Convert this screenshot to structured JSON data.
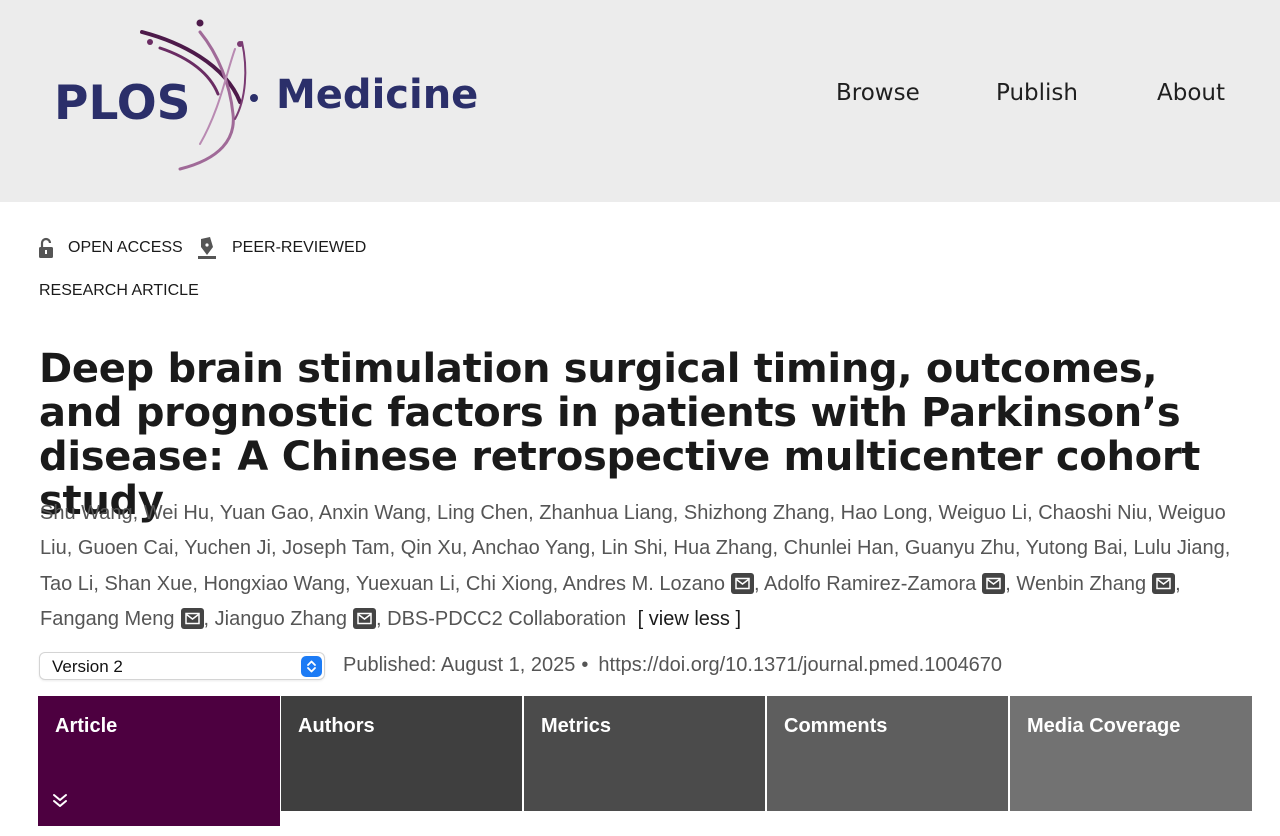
{
  "header": {
    "logo": {
      "plos": "PLOS",
      "journal": "Medicine"
    },
    "nav": [
      "Browse",
      "Publish",
      "About"
    ]
  },
  "badges": {
    "open_access": "OPEN ACCESS",
    "peer_reviewed": "PEER-REVIEWED"
  },
  "article_type": "RESEARCH ARTICLE",
  "title": "Deep brain stimulation surgical timing, outcomes, and prognostic factors in patients with Parkinson’s disease: A Chinese retrospective multicenter cohort study",
  "authors": [
    {
      "name": "Shu Wang",
      "email": false
    },
    {
      "name": "Wei Hu",
      "email": false
    },
    {
      "name": "Yuan Gao",
      "email": false
    },
    {
      "name": "Anxin Wang",
      "email": false
    },
    {
      "name": "Ling Chen",
      "email": false
    },
    {
      "name": "Zhanhua Liang",
      "email": false
    },
    {
      "name": "Shizhong Zhang",
      "email": false
    },
    {
      "name": "Hao Long",
      "email": false
    },
    {
      "name": "Weiguo Li",
      "email": false
    },
    {
      "name": "Chaoshi Niu",
      "email": false
    },
    {
      "name": "Weiguo Liu",
      "email": false
    },
    {
      "name": "Guoen Cai",
      "email": false
    },
    {
      "name": "Yuchen Ji",
      "email": false
    },
    {
      "name": "Joseph Tam",
      "email": false
    },
    {
      "name": "Qin Xu",
      "email": false
    },
    {
      "name": "Anchao Yang",
      "email": false
    },
    {
      "name": "Lin Shi",
      "email": false
    },
    {
      "name": "Hua Zhang",
      "email": false
    },
    {
      "name": "Chunlei Han",
      "email": false
    },
    {
      "name": "Guanyu Zhu",
      "email": false
    },
    {
      "name": "Yutong Bai",
      "email": false
    },
    {
      "name": "Lulu Jiang",
      "email": false
    },
    {
      "name": "Tao Li",
      "email": false
    },
    {
      "name": "Shan Xue",
      "email": false
    },
    {
      "name": "Hongxiao Wang",
      "email": false
    },
    {
      "name": "Yuexuan Li",
      "email": false
    },
    {
      "name": "Chi Xiong",
      "email": false
    },
    {
      "name": "Andres M. Lozano",
      "email": true
    },
    {
      "name": "Adolfo Ramirez-Zamora",
      "email": true
    },
    {
      "name": "Wenbin Zhang",
      "email": true
    },
    {
      "name": "Fangang Meng",
      "email": true
    },
    {
      "name": "Jianguo Zhang",
      "email": true
    },
    {
      "name": "DBS-PDCC2 Collaboration",
      "email": false
    }
  ],
  "view_less": "[ view less ]",
  "version": {
    "selected": "Version 2"
  },
  "published": {
    "text": "Published: August 1, 2025",
    "bullet": "•",
    "doi": "https://doi.org/10.1371/journal.pmed.1004670"
  },
  "tabs": [
    "Article",
    "Authors",
    "Metrics",
    "Comments",
    "Media Coverage"
  ],
  "icons": {
    "open_access": "unlocked-padlock-icon",
    "peer_reviewed": "pen-nib-icon",
    "email": "envelope-icon",
    "select": "updown-arrows-icon",
    "expand": "double-chevron-down-icon"
  },
  "colors": {
    "brand_navy": "#2b2f6a",
    "brand_purple": "#4d0040",
    "header_bg": "#ececec",
    "select_accent": "#1c7bf5"
  }
}
